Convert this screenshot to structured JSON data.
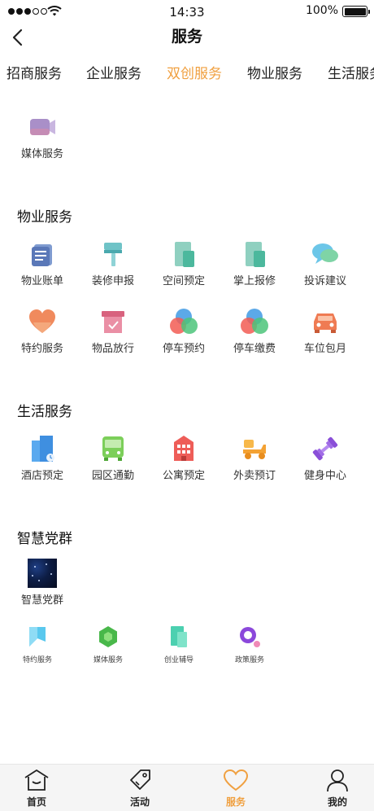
{
  "status_bar": {
    "time": "14:33",
    "battery": "100%"
  },
  "header": {
    "title": "服务"
  },
  "tabs": [
    {
      "label": "招商服务"
    },
    {
      "label": "企业服务"
    },
    {
      "label": "双创服务",
      "active": true
    },
    {
      "label": "物业服务"
    },
    {
      "label": "生活服务"
    }
  ],
  "shuangchuang": {
    "items": [
      {
        "label": "媒体服务",
        "icon": "camera-icon"
      }
    ]
  },
  "property": {
    "title": "物业服务",
    "items": [
      {
        "label": "物业账单",
        "icon": "bill-icon"
      },
      {
        "label": "装修申报",
        "icon": "paint-roller-icon"
      },
      {
        "label": "空间预定",
        "icon": "space-icon"
      },
      {
        "label": "掌上报修",
        "icon": "repair-icon"
      },
      {
        "label": "投诉建议",
        "icon": "chat-bubbles-icon"
      },
      {
        "label": "特约服务",
        "icon": "heart-icon"
      },
      {
        "label": "物品放行",
        "icon": "box-icon"
      },
      {
        "label": "停车预约",
        "icon": "circles-icon"
      },
      {
        "label": "停车缴费",
        "icon": "circles-icon"
      },
      {
        "label": "车位包月",
        "icon": "car-icon"
      }
    ]
  },
  "life": {
    "title": "生活服务",
    "items": [
      {
        "label": "酒店预定",
        "icon": "hotel-icon"
      },
      {
        "label": "园区通勤",
        "icon": "bus-icon"
      },
      {
        "label": "公寓预定",
        "icon": "apartment-icon"
      },
      {
        "label": "外卖预订",
        "icon": "scooter-icon"
      },
      {
        "label": "健身中心",
        "icon": "dumbbell-icon"
      }
    ]
  },
  "party": {
    "title": "智慧党群",
    "photo_item": {
      "label": "智慧党群"
    },
    "small_items": [
      {
        "label": "特约服务",
        "icon": "flag-icon"
      },
      {
        "label": "媒体服务",
        "icon": "hexagon-icon"
      },
      {
        "label": "创业辅导",
        "icon": "document-icon"
      },
      {
        "label": "政策服务",
        "icon": "search-q-icon"
      }
    ]
  },
  "tab_bar": [
    {
      "label": "首页",
      "icon": "home-icon"
    },
    {
      "label": "活动",
      "icon": "tag-icon"
    },
    {
      "label": "服务",
      "icon": "heart-outline-icon",
      "active": true
    },
    {
      "label": "我的",
      "icon": "person-icon"
    }
  ],
  "colors": {
    "accent": "#f0a040",
    "text": "#222222",
    "tab_bar_bg": "#f5f5f5"
  }
}
